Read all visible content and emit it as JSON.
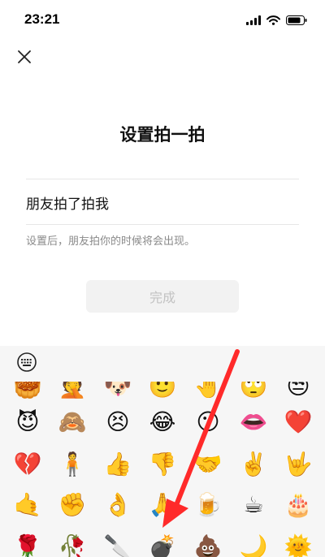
{
  "status": {
    "time": "23:21",
    "icons": [
      "signal-icon",
      "wifi-icon",
      "battery-icon"
    ]
  },
  "header": {
    "close_icon": "close-icon"
  },
  "main": {
    "title": "设置拍一拍",
    "input_value": "朋友拍了拍我",
    "hint": "设置后，朋友拍你的时候将会出现。",
    "done_label": "完成"
  },
  "emoji_panel": {
    "keyboard_icon": "keyboard-icon",
    "rows": [
      [
        "🥮",
        "🤦",
        "🐶",
        "🙂",
        "🤚",
        "🙄",
        "😒"
      ],
      [
        "😈",
        "🙈",
        "😣",
        "😂",
        "😶",
        "👄",
        "❤️"
      ],
      [
        "💔",
        "🧍",
        "👍",
        "👎",
        "🤝",
        "✌️",
        "🤟"
      ],
      [
        "🤙",
        "✊",
        "👌",
        "🙏",
        "🍺",
        "☕",
        "🎂"
      ],
      [
        "🌹",
        "🥀",
        "🔪",
        "💣",
        "💩",
        "🌙",
        "🌞"
      ]
    ]
  },
  "annotation": {
    "arrow_color": "#ff2a2a"
  },
  "colors": {
    "accent": "#ff2a2a",
    "button_bg": "#f2f2f2",
    "button_text": "#c2c2c2",
    "hint_text": "#8a8a8a",
    "panel_bg": "#f6f6f6"
  }
}
